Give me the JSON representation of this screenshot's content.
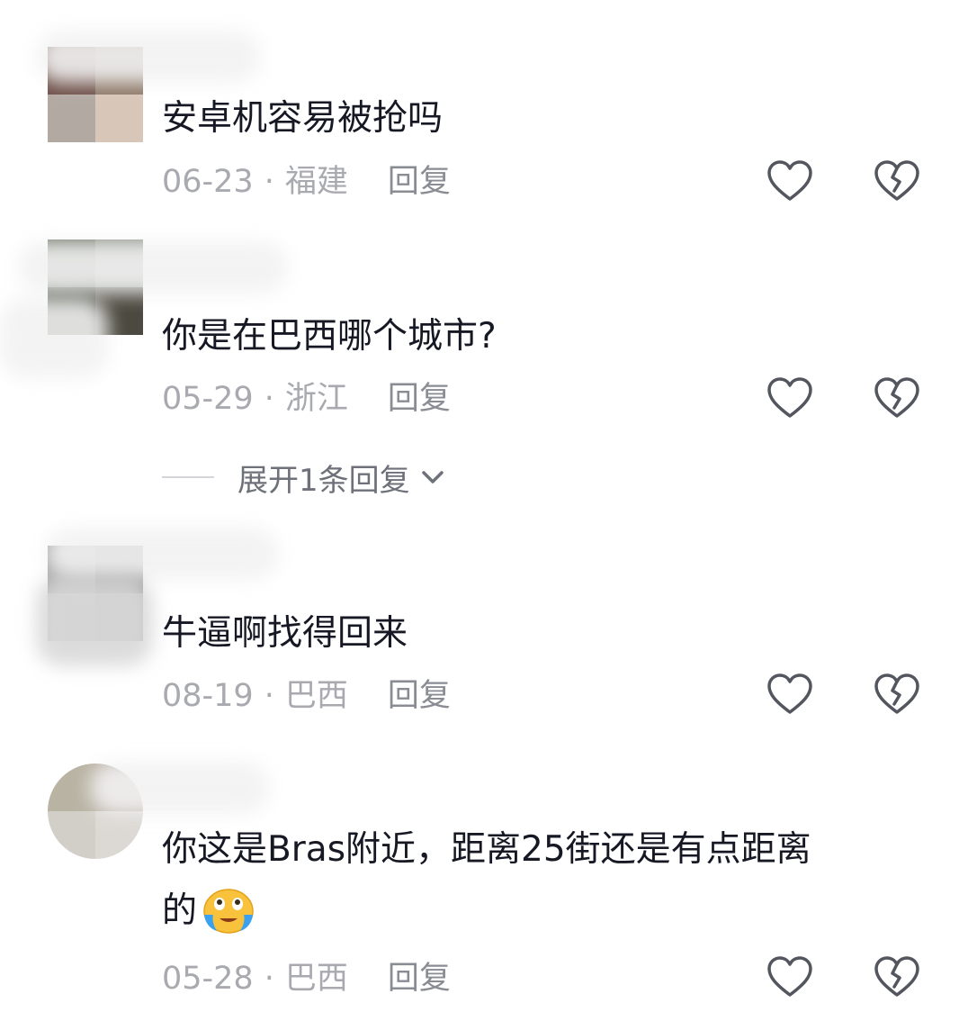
{
  "comments": [
    {
      "text": "安卓机容易被抢吗",
      "date": "06-23",
      "separator": "·",
      "location": "福建",
      "reply": "回复",
      "like_icon": "heart-outline-icon",
      "dislike_icon": "broken-heart-icon"
    },
    {
      "text": "你是在巴西哪个城市?",
      "date": "05-29",
      "separator": "·",
      "location": "浙江",
      "reply": "回复",
      "like_icon": "heart-outline-icon",
      "dislike_icon": "broken-heart-icon",
      "expand_label": "展开1条回复"
    },
    {
      "text": "牛逼啊找得回来",
      "date": "08-19",
      "separator": "·",
      "location": "巴西",
      "reply": "回复",
      "like_icon": "heart-outline-icon",
      "dislike_icon": "broken-heart-icon"
    },
    {
      "text_line1": "你这是Bras附近，距离25街还是有点距离",
      "text_line2": "的",
      "emoji": "crying-laughing-face-emoji",
      "date": "05-28",
      "separator": "·",
      "location": "巴西",
      "reply": "回复",
      "like_icon": "heart-outline-icon",
      "dislike_icon": "broken-heart-icon"
    }
  ],
  "colors": {
    "text": "#161823",
    "meta": "#a8aab0",
    "reply": "#8a8c94",
    "icon": "#54565f",
    "expand": "#6f717a"
  }
}
